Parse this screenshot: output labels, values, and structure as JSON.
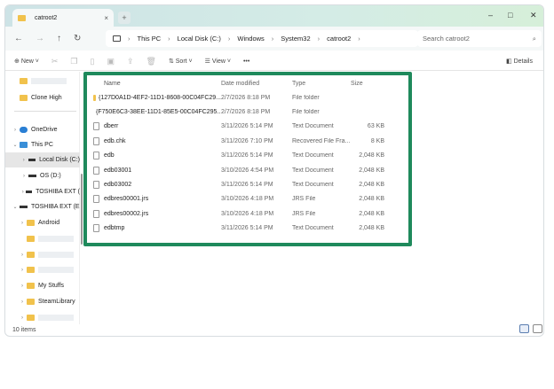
{
  "window": {
    "tab_title": "catroot2",
    "close": "×",
    "new_tab": "+",
    "minimize": "–",
    "maximize": "□",
    "close_window": "✕"
  },
  "address": {
    "back": "←",
    "forward": "→",
    "up": "↑",
    "refresh": "↻",
    "crumbs": [
      "This PC",
      "Local Disk (C:)",
      "Windows",
      "System32",
      "catroot2"
    ],
    "sep": "›",
    "search_placeholder": "Search catroot2"
  },
  "toolbar": {
    "new": "New",
    "sort": "Sort",
    "view": "View",
    "more": "•••",
    "details": "Details"
  },
  "sidebar": {
    "items": [
      {
        "label": "",
        "type": "folder",
        "blurred": true
      },
      {
        "label": "Clone High",
        "type": "folder"
      },
      {
        "label": "OneDrive",
        "type": "cloud",
        "chev": "›"
      },
      {
        "label": "This PC",
        "type": "pc",
        "chev": "⌄"
      },
      {
        "label": "Local Disk (C:)",
        "type": "drive",
        "chev": "›",
        "selected": true
      },
      {
        "label": "OS (D:)",
        "type": "drive",
        "chev": "›"
      },
      {
        "label": "TOSHIBA EXT (",
        "type": "drive",
        "chev": "›"
      },
      {
        "label": "TOSHIBA EXT (E",
        "type": "drive",
        "chev": "⌄"
      },
      {
        "label": "Android",
        "type": "folder",
        "chev": "›"
      },
      {
        "label": "",
        "type": "folder",
        "blurred": true
      },
      {
        "label": "",
        "type": "folder",
        "blurred": true,
        "chev": "›"
      },
      {
        "label": "",
        "type": "folder",
        "blurred": true,
        "chev": "›"
      },
      {
        "label": "My Stuffs",
        "type": "folder",
        "chev": "›"
      },
      {
        "label": "SteamLibrary",
        "type": "folder",
        "chev": "›"
      },
      {
        "label": "",
        "type": "folder",
        "blurred": true,
        "chev": "›"
      }
    ]
  },
  "columns": {
    "name": "Name",
    "date": "Date modified",
    "type": "Type",
    "size": "Size"
  },
  "files": [
    {
      "name": "{127D0A1D-4EF2-11D1-8608-00C04FC29...",
      "date": "2/7/2026 8:18 PM",
      "type": "File folder",
      "size": "",
      "folder": true
    },
    {
      "name": "{F750E6C3-38EE-11D1-85E5-00C04FC295...",
      "date": "2/7/2026 8:18 PM",
      "type": "File folder",
      "size": "",
      "folder": true
    },
    {
      "name": "dberr",
      "date": "3/11/2026 5:14 PM",
      "type": "Text Document",
      "size": "63 KB"
    },
    {
      "name": "edb.chk",
      "date": "3/11/2026 7:10 PM",
      "type": "Recovered File Fra...",
      "size": "8 KB"
    },
    {
      "name": "edb",
      "date": "3/11/2026 5:14 PM",
      "type": "Text Document",
      "size": "2,048 KB"
    },
    {
      "name": "edb03001",
      "date": "3/10/2026 4:54 PM",
      "type": "Text Document",
      "size": "2,048 KB"
    },
    {
      "name": "edb03002",
      "date": "3/11/2026 5:14 PM",
      "type": "Text Document",
      "size": "2,048 KB"
    },
    {
      "name": "edbres00001.jrs",
      "date": "3/10/2026 4:18 PM",
      "type": "JRS File",
      "size": "2,048 KB"
    },
    {
      "name": "edbres00002.jrs",
      "date": "3/10/2026 4:18 PM",
      "type": "JRS File",
      "size": "2,048 KB"
    },
    {
      "name": "edbtmp",
      "date": "3/11/2026 5:14 PM",
      "type": "Text Document",
      "size": "2,048 KB"
    }
  ],
  "status": {
    "count": "10 items"
  },
  "colors": {
    "highlight": "#1f8a5c",
    "folder": "#f1c24c"
  }
}
